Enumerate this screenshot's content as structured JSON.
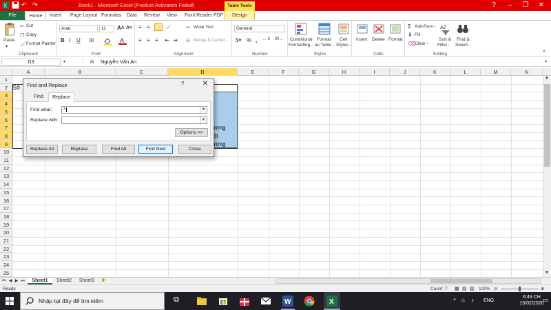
{
  "title_bar": {
    "title": "Book1 - Microsoft Excel (Product Activation Failed)",
    "context_tab": "Table Tools",
    "colors": {
      "bar": "#e00000",
      "context": "#ffe14d"
    }
  },
  "ribbon_tabs": [
    "File",
    "Home",
    "Insert",
    "Page Layout",
    "Formulas",
    "Data",
    "Review",
    "View",
    "Foxit Reader PDF",
    "Design"
  ],
  "ribbon": {
    "clipboard": {
      "paste": "Paste",
      "cut": "Cut",
      "copy": "Copy -",
      "format_painter": "Format Painter",
      "label": "Clipboard"
    },
    "font": {
      "name": "Arial",
      "size": "11",
      "label": "Font"
    },
    "alignment": {
      "wrap": "Wrap Text",
      "merge": "Merge & Center -",
      "label": "Alignment"
    },
    "number": {
      "format": "General",
      "label": "Number"
    },
    "styles": {
      "cond": "Conditional",
      "cond2": "Formatting -",
      "fat": "Format",
      "fat2": "as Table -",
      "cell": "Cell",
      "cell2": "Styles -",
      "label": "Styles"
    },
    "cells": {
      "insert": "Insert",
      "delete": "Delete",
      "format": "Format",
      "label": "Cells"
    },
    "editing": {
      "autosum": "AutoSum -",
      "fill": "Fill -",
      "clear": "Clear -",
      "sort": "Sort &",
      "sort2": "Filter -",
      "find": "Find &",
      "find2": "Select -",
      "label": "Editing"
    }
  },
  "formula_bar": {
    "name_box": "D3",
    "fx": "fx",
    "content": "Nguyễn Văn An"
  },
  "grid": {
    "columns": [
      "A",
      "B",
      "C",
      "D",
      "E",
      "F",
      "G",
      "H",
      "I",
      "J",
      "K",
      "L",
      "M",
      "N"
    ],
    "rows": [
      "1",
      "2",
      "3",
      "4",
      "5",
      "6",
      "7",
      "8",
      "9",
      "10",
      "11",
      "12",
      "13",
      "14",
      "15",
      "16",
      "17",
      "18",
      "19",
      "20",
      "21",
      "22",
      "23",
      "24",
      "25"
    ],
    "cells": {
      "a2": "Số",
      "d7": "ương",
      "d8": "iệt",
      "d9": "ương"
    }
  },
  "dialog": {
    "title": "Find and Replace",
    "help": "?",
    "close": "✕",
    "tabs": {
      "find": "Find",
      "replace": "Replace"
    },
    "find_label": "Find what:",
    "find_value": "*",
    "replace_label": "Replace with:",
    "replace_value": "",
    "options_btn": "Options >>",
    "btn_replace_all": "Replace All",
    "btn_replace": "Replace",
    "btn_find_all": "Find All",
    "btn_find_next": "Find Next",
    "btn_close": "Close"
  },
  "sheets": [
    "Sheet1",
    "Sheet2",
    "Sheet3"
  ],
  "status": {
    "left": "Ready",
    "count": "Count: 7",
    "zoom": "100%"
  },
  "taskbar": {
    "search_placeholder": "Nhập tại đây để tìm kiếm",
    "lang": "ENG",
    "time": "6:49 CH",
    "date": "15/02/2020"
  }
}
